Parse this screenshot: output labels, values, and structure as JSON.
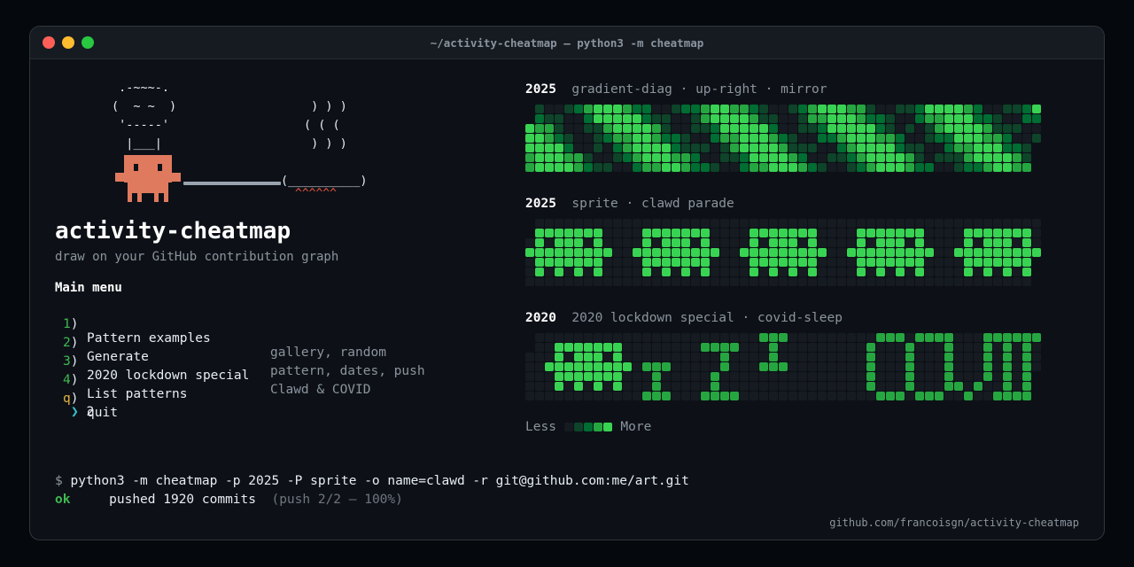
{
  "window": {
    "title": "~/activity-cheatmap — python3 -m cheatmap"
  },
  "ascii": {
    "hat": " .-~~~-.\n(  ~ ~  )\n '-----'\n  |___|",
    "steam": " ) ) )\n( ( (\n ) ) )",
    "pot": "(__________)",
    "flames": "^^^^^^"
  },
  "app": {
    "title": "activity-cheatmap",
    "subtitle": "draw on your GitHub contribution graph"
  },
  "menu": {
    "heading": "Main menu",
    "items": [
      {
        "key": "1",
        "label": "Pattern examples",
        "hint": "gallery, random"
      },
      {
        "key": "2",
        "label": "Generate",
        "hint": "pattern, dates, push"
      },
      {
        "key": "3",
        "label": "2020 lockdown special",
        "hint": "Clawd & COVID"
      },
      {
        "key": "4",
        "label": "List patterns",
        "hint": ""
      },
      {
        "key": "q",
        "label": "quit",
        "hint": ""
      }
    ],
    "key_suffix": ")",
    "prompt_symbol": "❯",
    "prompt_value": "2"
  },
  "previews": [
    {
      "year": "2025",
      "label": "gradient-diag · up-right · mirror",
      "pattern": "gradient"
    },
    {
      "year": "2025",
      "label": "sprite · clawd parade",
      "pattern": "sprite"
    },
    {
      "year": "2020",
      "label": "2020 lockdown special · covid-sleep",
      "pattern": "covid"
    }
  ],
  "legend": {
    "less": "Less",
    "more": "More",
    "levels": [
      "#161b22",
      "#0e4429",
      "#006d32",
      "#26a641",
      "#39d353"
    ]
  },
  "terminal": {
    "prompt": "$",
    "command": "python3 -m cheatmap -p 2025 -P sprite -o name=clawd -r git@github.com:me/art.git",
    "status_ok": "ok",
    "status_text": "pushed 1920 commits",
    "status_detail": "(push 2/2 — 100%)"
  },
  "footer": {
    "link": "github.com/francoisgn/activity-cheatmap"
  },
  "colors": {
    "sprite": "#e07a5f",
    "accent_green": "#3fb950",
    "accent_cyan": "#39c5cf",
    "accent_yellow": "#e3b341"
  }
}
